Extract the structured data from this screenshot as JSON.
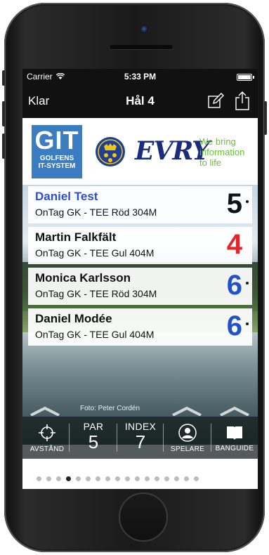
{
  "status": {
    "carrier": "Carrier",
    "time": "5:33 PM"
  },
  "nav": {
    "back_label": "Klar",
    "title": "Hål 4"
  },
  "banner": {
    "git_big": "GIT",
    "git_small1": "GOLFENS",
    "git_small2": "IT-SYSTEM",
    "evry": "EVRY",
    "tagline1": "We bring",
    "tagline2": "information",
    "tagline3": "to life"
  },
  "players": [
    {
      "name": "Daniel Test",
      "tee": "OnTag GK - TEE Röd  304M",
      "score": "5",
      "score_color": "#111111",
      "name_color": "#2b4fd0"
    },
    {
      "name": "Martin Falkfält",
      "tee": "OnTag GK - TEE Gul  404M",
      "score": "4",
      "score_color": "#e3262b",
      "name_color": "#111111"
    },
    {
      "name": "Monica Karlsson",
      "tee": "OnTag GK - TEE Röd  304M",
      "score": "6",
      "score_color": "#2152c9",
      "name_color": "#111111"
    },
    {
      "name": "Daniel Modée",
      "tee": "OnTag GK - TEE Gul  404M",
      "score": "6",
      "score_color": "#2152c9",
      "name_color": "#111111"
    }
  ],
  "photo_credit": "Foto: Peter Cordén",
  "toolbar": {
    "distance_label": "AVSTÅND",
    "par_label": "PAR",
    "par_value": "5",
    "index_label": "INDEX",
    "index_value": "7",
    "players_label": "SPELARE",
    "guide_label": "BANGUIDE"
  },
  "pager": {
    "page_count": 17,
    "active_page": 4
  }
}
